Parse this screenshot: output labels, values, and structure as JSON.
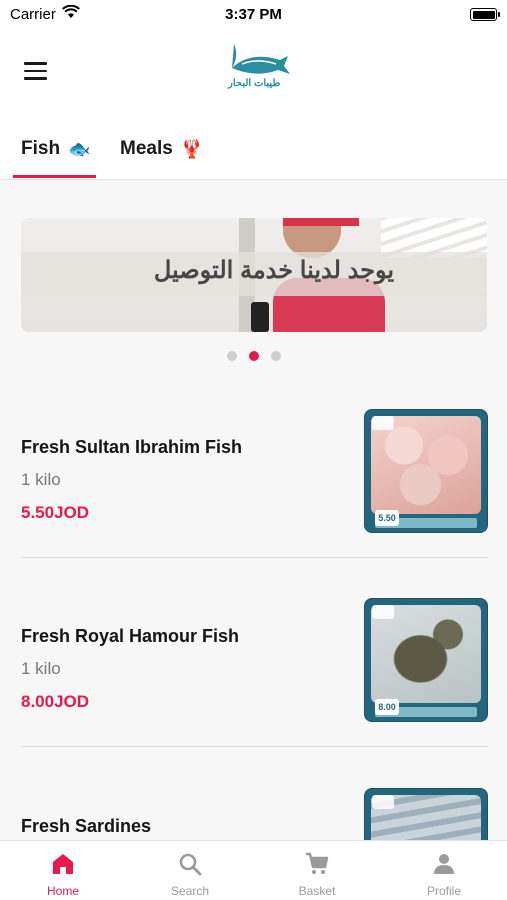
{
  "status_bar": {
    "carrier": "Carrier",
    "time": "3:37 PM"
  },
  "header": {
    "logo_text": "طيبات البحار",
    "menu_icon": "hamburger-menu-icon"
  },
  "tabs": [
    {
      "label": "Fish",
      "emoji": "🐟",
      "active": true
    },
    {
      "label": "Meals",
      "emoji": "🦞",
      "active": false
    }
  ],
  "banner": {
    "caption": "يوجد لدينا خدمة التوصيل",
    "slides": 3,
    "active_slide": 2
  },
  "products": [
    {
      "name": "Fresh Sultan Ibrahim Fish",
      "quantity": "1 kilo",
      "price": "5.50JOD",
      "tag": "5.50"
    },
    {
      "name": "Fresh Royal Hamour Fish",
      "quantity": "1 kilo",
      "price": "8.00JOD",
      "tag": "8.00"
    },
    {
      "name": "Fresh Sardines",
      "quantity": "",
      "price": ""
    }
  ],
  "bottom_nav": [
    {
      "label": "Home",
      "icon": "home-icon",
      "active": true
    },
    {
      "label": "Search",
      "icon": "search-icon",
      "active": false
    },
    {
      "label": "Basket",
      "icon": "cart-icon",
      "active": false
    },
    {
      "label": "Profile",
      "icon": "profile-icon",
      "active": false
    }
  ],
  "colors": {
    "accent": "#e8194d",
    "muted": "#9a9a9a",
    "brand_teal": "#2a8ea0"
  }
}
